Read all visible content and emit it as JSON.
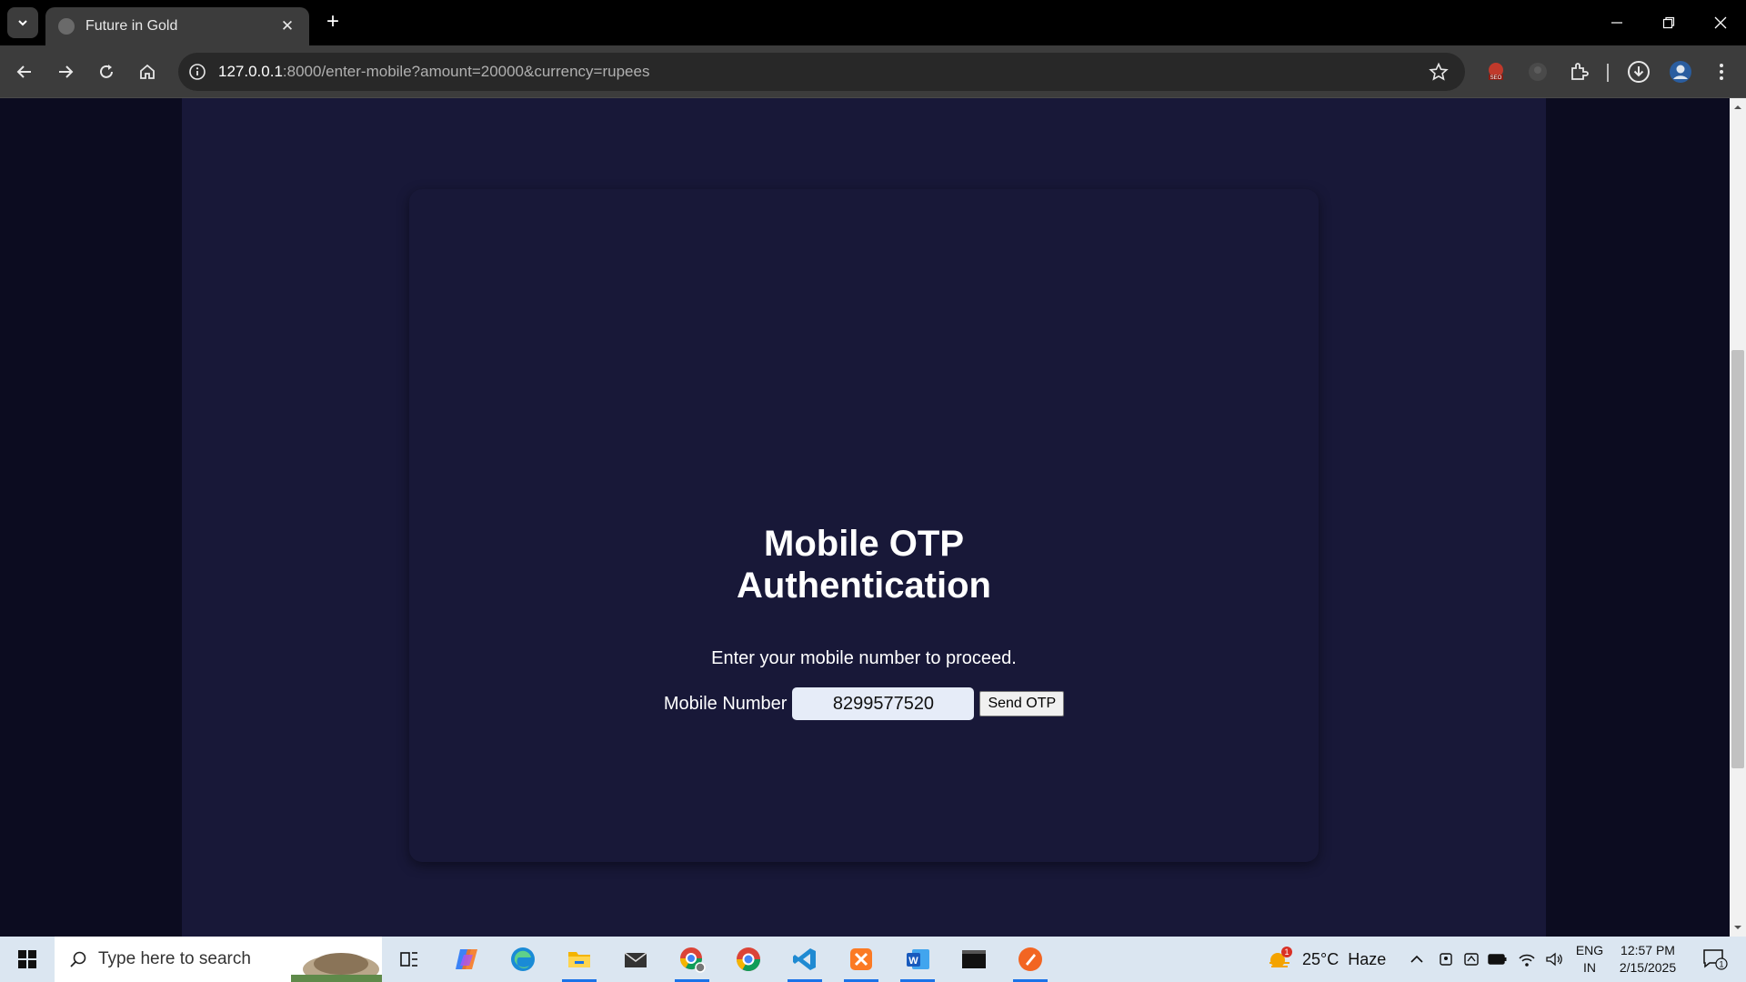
{
  "browser": {
    "tab_title": "Future in Gold",
    "url_host": "127.0.0.1",
    "url_path": ":8000/enter-mobile?amount=20000&currency=rupees"
  },
  "page": {
    "title_line1": "Mobile OTP",
    "title_line2": "Authentication",
    "subtitle": "Enter your mobile number to proceed.",
    "mobile_label": "Mobile Number",
    "mobile_value": "8299577520",
    "send_button": "Send OTP"
  },
  "taskbar": {
    "search_placeholder": "Type here to search",
    "weather_temp": "25°C",
    "weather_desc": "Haze",
    "lang_line1": "ENG",
    "lang_line2": "IN",
    "time": "12:57 PM",
    "date": "2/15/2025",
    "notification_count": "1",
    "weather_badge": "1"
  },
  "colors": {
    "page_background": "#181838",
    "outer_background": "#0c0c20",
    "chrome_toolbar": "#3c3c3c",
    "input_background": "#e6ecf8",
    "taskbar": "#dbe6f1"
  },
  "icons": [
    "tab-search-icon",
    "close-icon",
    "plus-icon",
    "minimize-icon",
    "restore-icon",
    "back-icon",
    "forward-icon",
    "reload-icon",
    "home-icon",
    "info-icon",
    "star-icon",
    "seo-extension-icon",
    "profile-extension-icon",
    "extensions-puzzle-icon",
    "download-icon",
    "avatar",
    "kebab-menu-icon",
    "windows-start-icon",
    "search-icon",
    "task-view-icon",
    "copilot-icon",
    "edge-icon",
    "file-explorer-icon",
    "mail-icon",
    "chrome-profile-icon",
    "chrome-icon",
    "vscode-icon",
    "xampp-icon",
    "word-icon",
    "terminal-icon",
    "sublime-icon",
    "weather-icon",
    "chevron-up-icon",
    "meet-icon",
    "network-badge-icon",
    "battery-icon",
    "wifi-icon",
    "volume-icon",
    "notification-icon"
  ]
}
